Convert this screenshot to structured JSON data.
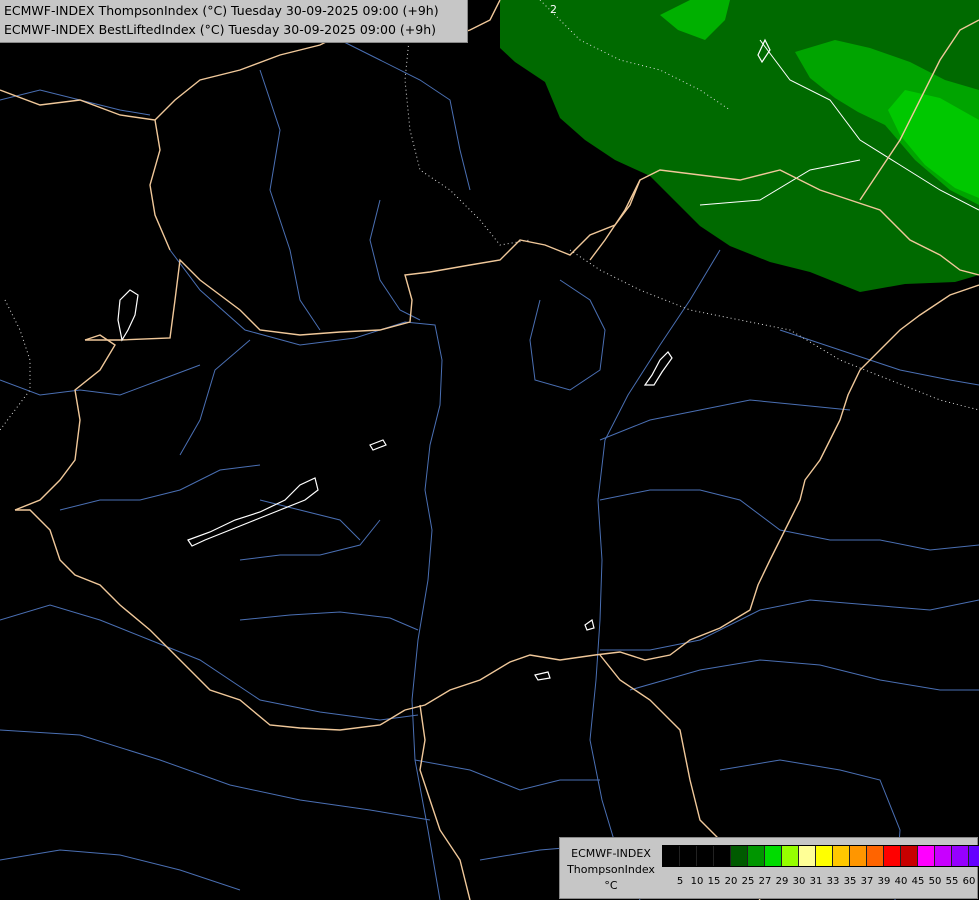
{
  "title": {
    "line1": "ECMWF-INDEX ThompsonIndex (°C) Tuesday 30-09-2025 09:00 (+9h)",
    "line2": "ECMWF-INDEX BestLiftedIndex (°C) Tuesday 30-09-2025 09:00 (+9h)"
  },
  "map": {
    "background": "#000000",
    "contour_label": "2",
    "colors": {
      "border": "#f0c89a",
      "river": "#4a6fb3",
      "lake": "#ffffff",
      "contour": "#ffffff",
      "field_dark": "#006a00",
      "field_mid": "#00a400",
      "field_light": "#00c800"
    }
  },
  "legend": {
    "name_line1": "ECMWF-INDEX",
    "name_line2": "ThompsonIndex",
    "unit": "°C",
    "swatch_colors": [
      "#000000",
      "#000000",
      "#000000",
      "#000000",
      "#005a00",
      "#009600",
      "#00dc00",
      "#96ff00",
      "#ffff96",
      "#ffff00",
      "#ffc800",
      "#ff9600",
      "#ff6400",
      "#ff0000",
      "#c80000",
      "#ff00ff",
      "#c800ff",
      "#9600ff",
      "#6400ff",
      "#0000ff"
    ],
    "ticks": [
      "5",
      "10",
      "15",
      "20",
      "25",
      "27",
      "29",
      "30",
      "31",
      "33",
      "35",
      "37",
      "39",
      "40",
      "45",
      "50",
      "55",
      "60"
    ]
  }
}
